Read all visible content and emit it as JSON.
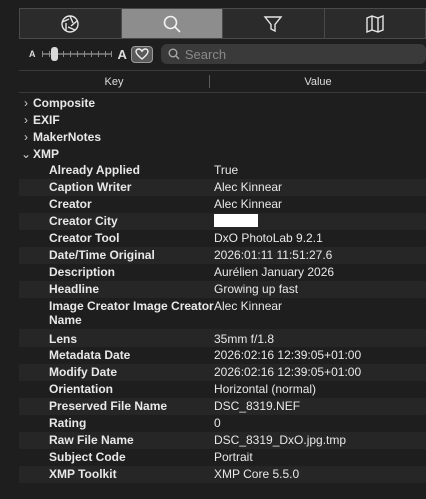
{
  "tabs": [
    {
      "icon": "aperture-icon",
      "active": false
    },
    {
      "icon": "search-icon",
      "active": true
    },
    {
      "icon": "filter-icon",
      "active": false
    },
    {
      "icon": "map-icon",
      "active": false
    }
  ],
  "filter": {
    "small_label": "A",
    "large_label": "A",
    "slider_level": 0.15,
    "search_placeholder": "Search"
  },
  "columns": {
    "key": "Key",
    "value": "Value"
  },
  "groups": [
    {
      "label": "Composite",
      "expanded": false
    },
    {
      "label": "EXIF",
      "expanded": false
    },
    {
      "label": "MakerNotes",
      "expanded": false
    },
    {
      "label": "XMP",
      "expanded": true
    }
  ],
  "xmp_rows": [
    {
      "key": "Already Applied",
      "value": "True"
    },
    {
      "key": "Caption Writer",
      "value": "Alec Kinnear"
    },
    {
      "key": "Creator",
      "value": "Alec Kinnear"
    },
    {
      "key": "Creator City",
      "value": ""
    },
    {
      "key": "Creator Tool",
      "value": "DxO PhotoLab 9.2.1"
    },
    {
      "key": "Date/Time Original",
      "value": "2026:01:11 11:51:27.6"
    },
    {
      "key": "Description",
      "value": "Aurélien January 2026"
    },
    {
      "key": "Headline",
      "value": "Growing up fast"
    },
    {
      "key": "Image Creator Image Creator Name",
      "value": "Alec Kinnear"
    },
    {
      "key": "Lens",
      "value": "35mm f/1.8"
    },
    {
      "key": "Metadata Date",
      "value": "2026:02:16 12:39:05+01:00"
    },
    {
      "key": "Modify Date",
      "value": "2026:02:16 12:39:05+01:00"
    },
    {
      "key": "Orientation",
      "value": "Horizontal (normal)"
    },
    {
      "key": "Preserved File Name",
      "value": "DSC_8319.NEF"
    },
    {
      "key": "Rating",
      "value": "0"
    },
    {
      "key": "Raw File Name",
      "value": "DSC_8319_DxO.jpg.tmp"
    },
    {
      "key": "Subject Code",
      "value": "Portrait"
    },
    {
      "key": "XMP Toolkit",
      "value": "XMP Core 5.5.0"
    }
  ],
  "colors": {
    "background": "#1e1e1e",
    "active_tab": "#8d8d8d",
    "alt_row": "#262626",
    "redacted_value": "#ffffff"
  }
}
